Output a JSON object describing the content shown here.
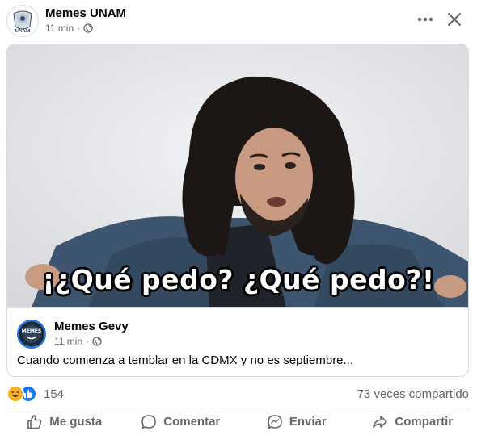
{
  "post": {
    "page_name": "Memes UNAM",
    "time": "11 min",
    "separator": "·",
    "avatar_text": "UNAM",
    "menu_label": "Más opciones",
    "close_label": "Cerrar"
  },
  "shared": {
    "meme_caption": "¡¿Qué pedo? ¿Qué pedo?!",
    "page_name": "Memes Gevy",
    "avatar_text": "MEMES",
    "time": "11 min",
    "separator": "·",
    "text": "Cuando comienza a temblar en la CDMX y no es septiembre..."
  },
  "stats": {
    "reaction_count": "154",
    "shares": "73 veces compartido",
    "reactions": [
      "haha-icon",
      "like-icon"
    ]
  },
  "actions": [
    {
      "label": "Me gusta",
      "icon": "like-icon"
    },
    {
      "label": "Comentar",
      "icon": "comment-icon"
    },
    {
      "label": "Enviar",
      "icon": "send-icon"
    },
    {
      "label": "Compartir",
      "icon": "share-icon"
    }
  ],
  "colors": {
    "accent": "#1877f2",
    "secondary_text": "#65676b",
    "haha": "#f7b125"
  }
}
